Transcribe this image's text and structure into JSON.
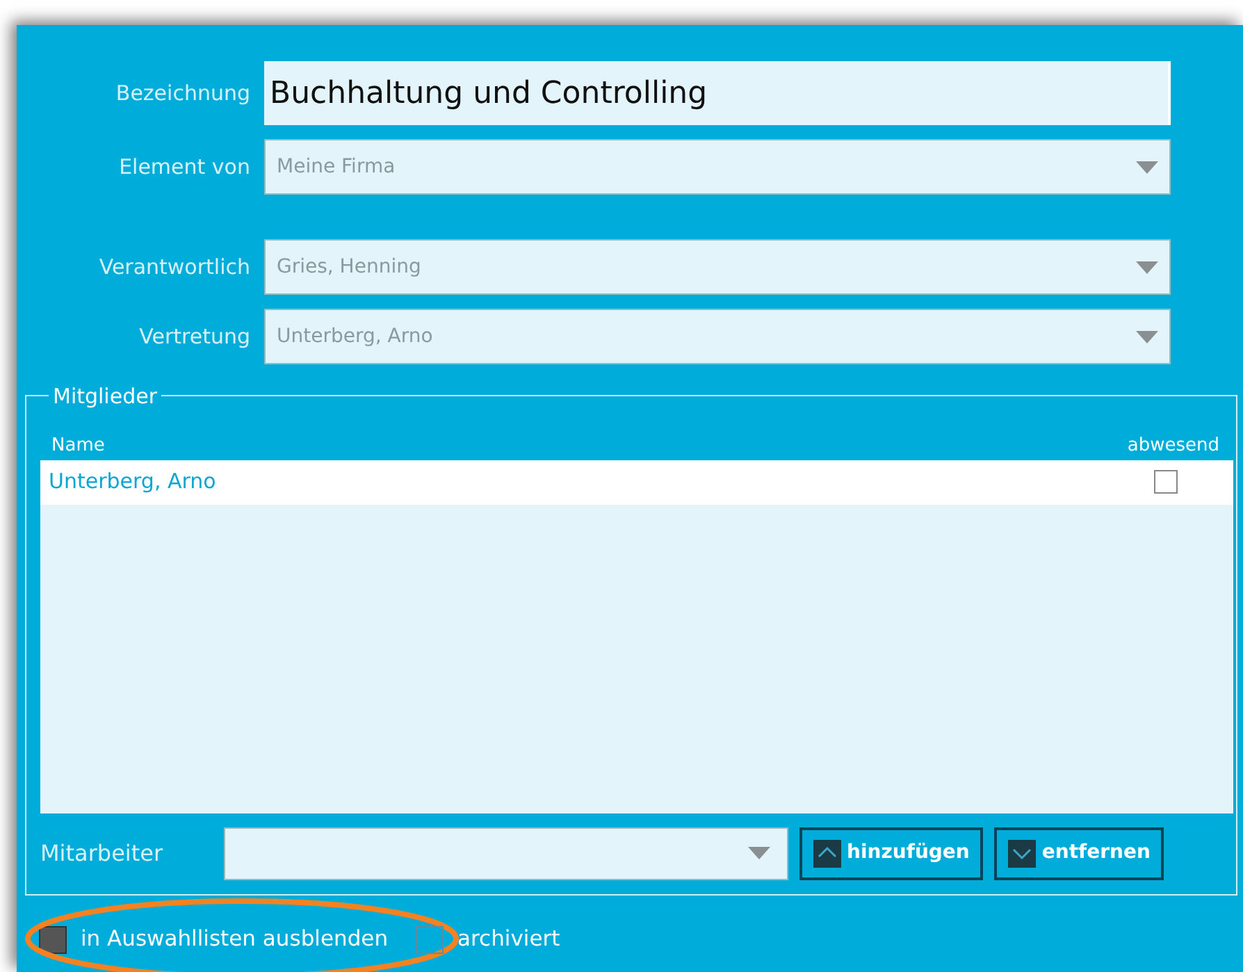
{
  "form": {
    "name": {
      "label": "Bezeichnung",
      "value": "Buchhaltung und Controlling"
    },
    "selects": [
      {
        "label": "Element von",
        "value": "Meine Firma",
        "gap_before": false
      },
      {
        "label": "Verantwortlich",
        "value": "Gries, Henning",
        "gap_before": true
      },
      {
        "label": "Vertretung",
        "value": "Unterberg, Arno",
        "gap_before": false
      }
    ]
  },
  "members": {
    "title": "Mitglieder",
    "columns": [
      "Name",
      "abwesend"
    ],
    "rows": [
      {
        "name": "Unterberg, Arno",
        "absent": false,
        "selected": true
      }
    ],
    "employee": {
      "label": "Mitarbeiter"
    },
    "buttons": [
      {
        "label": "hinzufügen",
        "kind": "up"
      },
      {
        "label": "entfernen",
        "kind": "down"
      }
    ]
  },
  "options": [
    {
      "label": "in Auswahllisten ausblenden",
      "checked": true,
      "highlighted": true
    },
    {
      "label": "archiviert",
      "checked": false,
      "highlighted": false
    }
  ],
  "annotation": {
    "kind": "ellipse",
    "color": "#f58220"
  }
}
